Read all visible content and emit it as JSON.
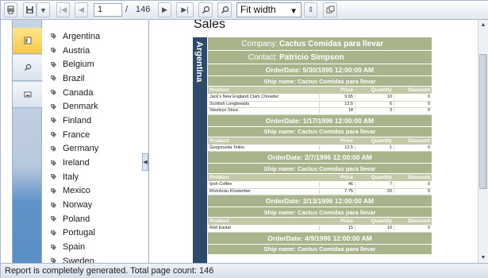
{
  "toolbar": {
    "page_current": "1",
    "page_separator": "/",
    "page_total": "146",
    "zoom_value": "Fit width"
  },
  "sidebar": {
    "countries": [
      "Argentina",
      "Austria",
      "Belgium",
      "Brazil",
      "Canada",
      "Denmark",
      "Finland",
      "France",
      "Germany",
      "Ireland",
      "Italy",
      "Mexico",
      "Norway",
      "Poland",
      "Portugal",
      "Spain",
      "Sweden"
    ]
  },
  "report": {
    "title": "Sales",
    "group_label": "Argentina",
    "company_label": "Company:",
    "company_value": "Cactus Comidas para llevar",
    "contact_label": "Contact:",
    "contact_value": "Patricio Simpson",
    "columns": [
      "Product",
      "Price",
      "Quantity",
      "Discount"
    ],
    "orders": [
      {
        "order": "OrderDate: 5/30/1995 12:00:00 AM",
        "ship": "Ship name: Cactus Comidas para llevar",
        "items": [
          [
            "Jack's New England Clam Chowder",
            "9.65",
            "10",
            "0"
          ],
          [
            "Scottish Longbreads",
            "12.5",
            "6",
            "0"
          ],
          [
            "Steeleye Stout",
            "18",
            "3",
            "0"
          ]
        ]
      },
      {
        "order": "OrderDate: 1/17/1996 12:00:00 AM",
        "ship": "Ship name: Cactus Comidas para llevar",
        "items": [
          [
            "Gorgonzola Telino",
            "12.5",
            "1",
            "0"
          ]
        ]
      },
      {
        "order": "OrderDate: 2/7/1996 12:00:00 AM",
        "ship": "Ship name: Cactus Comidas para llevar",
        "items": [
          [
            "Ipoh Coffee",
            "46",
            "7",
            "0"
          ],
          [
            "Rhönbräu Klosterbier",
            "7.75",
            "20",
            "0"
          ]
        ]
      },
      {
        "order": "OrderDate: 3/13/1996 12:00:00 AM",
        "ship": "Ship name: Cactus Comidas para llevar",
        "items": [
          [
            "Röd Kaviar",
            "15",
            "10",
            "0"
          ]
        ]
      },
      {
        "order": "OrderDate: 4/9/1996 12:00:00 AM",
        "ship": "Ship name: Cactus Comidas para llevar",
        "items": []
      }
    ]
  },
  "status": {
    "text": "Report is completely generated. Total page count: 146"
  }
}
